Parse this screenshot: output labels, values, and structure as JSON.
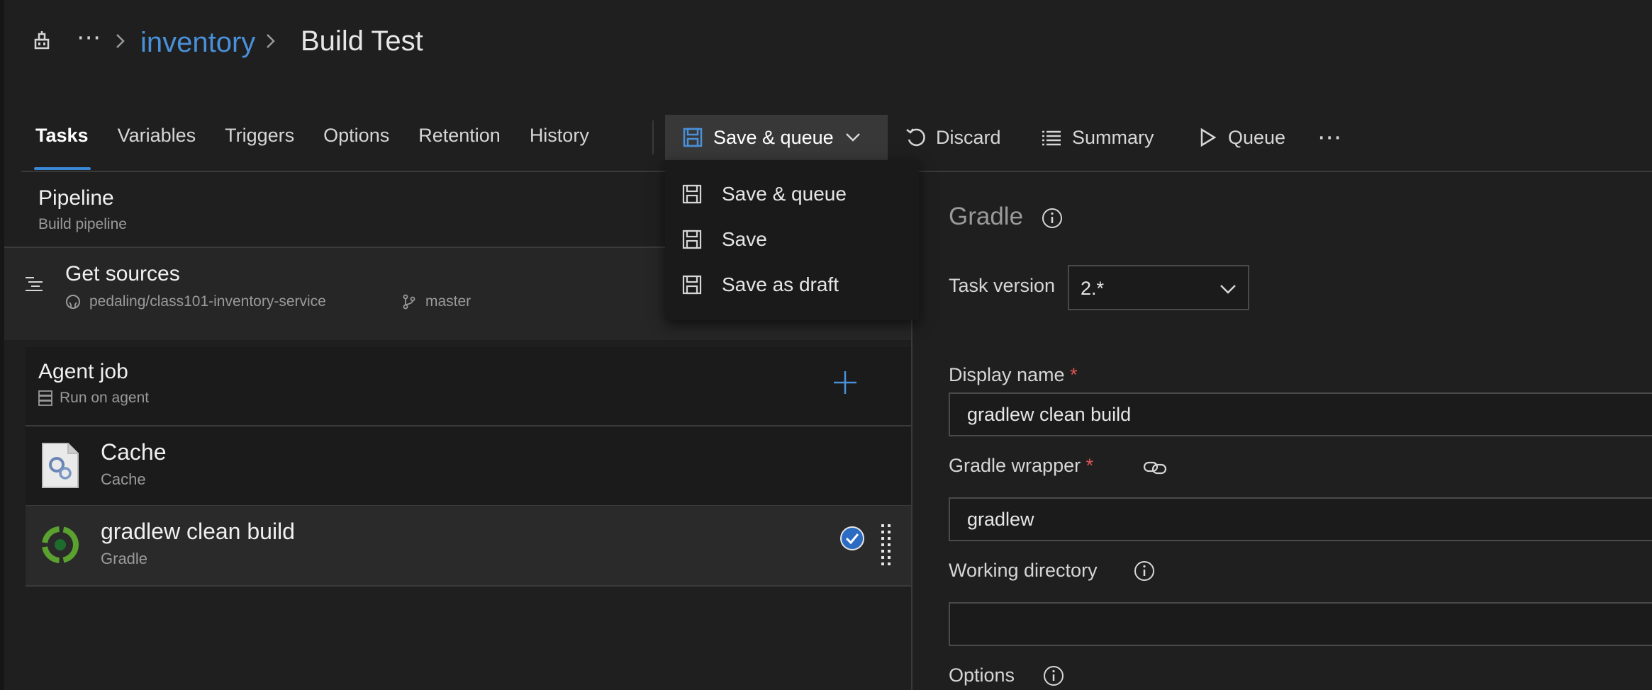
{
  "breadcrumb": {
    "more": "⋯",
    "project": "inventory",
    "title": "Build Test"
  },
  "tabs": [
    {
      "label": "Tasks",
      "active": true
    },
    {
      "label": "Variables"
    },
    {
      "label": "Triggers"
    },
    {
      "label": "Options"
    },
    {
      "label": "Retention"
    },
    {
      "label": "History"
    }
  ],
  "toolbar": {
    "save_queue": "Save & queue",
    "discard": "Discard",
    "summary": "Summary",
    "queue": "Queue",
    "more": "⋯"
  },
  "dropdown": {
    "items": [
      "Save & queue",
      "Save",
      "Save as draft"
    ]
  },
  "pipeline": {
    "title": "Pipeline",
    "subtitle": "Build pipeline"
  },
  "get_sources": {
    "title": "Get sources",
    "repo": "pedaling/class101-inventory-service",
    "branch": "master"
  },
  "agent_job": {
    "title": "Agent job",
    "subtitle": "Run on agent"
  },
  "tasks": [
    {
      "title": "Cache",
      "subtitle": "Cache"
    },
    {
      "title": "gradlew clean build",
      "subtitle": "Gradle"
    }
  ],
  "detail": {
    "title": "Gradle",
    "task_version_label": "Task version",
    "task_version_value": "2.*",
    "display_name_label": "Display name",
    "display_name_value": "gradlew clean build",
    "gradle_wrapper_label": "Gradle wrapper",
    "gradle_wrapper_value": "gradlew",
    "working_directory_label": "Working directory",
    "working_directory_value": "",
    "options_label": "Options",
    "required_mark": "*"
  },
  "colors": {
    "accent": "#3a87d6",
    "link": "#4a90d9",
    "required": "#e05555",
    "background": "#1f1f1f"
  }
}
